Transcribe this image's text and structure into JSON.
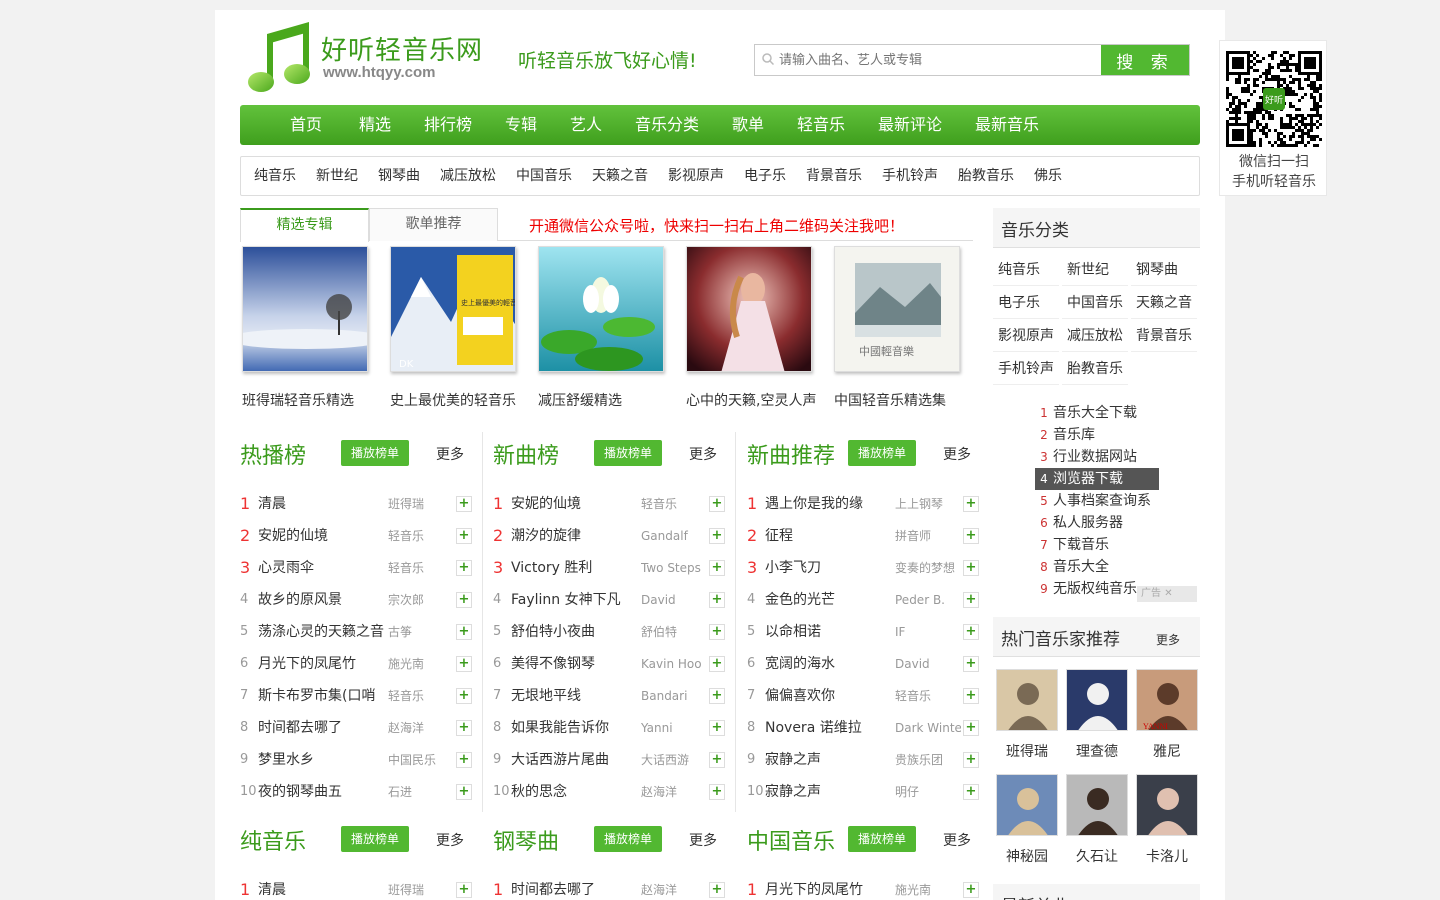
{
  "header": {
    "logo_text": "好听轻音乐网",
    "domain": "www.htqyy.com",
    "slogan": "听轻音乐放飞好心情!",
    "search_placeholder": "请输入曲名、艺人或专辑",
    "search_button": "搜 索"
  },
  "nav": [
    "首页",
    "精选",
    "排行榜",
    "专辑",
    "艺人",
    "音乐分类",
    "歌单",
    "轻音乐",
    "最新评论",
    "最新音乐"
  ],
  "subnav": [
    "纯音乐",
    "新世纪",
    "钢琴曲",
    "减压放松",
    "中国音乐",
    "天籁之音",
    "影视原声",
    "电子乐",
    "背景音乐",
    "手机铃声",
    "胎教音乐",
    "佛乐"
  ],
  "tabs": [
    "精选专辑",
    "歌单推荐"
  ],
  "notice": "开通微信公众号啦，快来扫一扫右上角二维码关注我吧！",
  "albums": [
    "班得瑞轻音乐精选",
    "史上最优美的轻音乐",
    "减压舒缓精选",
    "心中的天籁,空灵人声",
    "中国轻音乐精选集"
  ],
  "album_cover_text": [
    "史上最優美的輕音樂",
    "中國輕音樂"
  ],
  "charts": [
    {
      "title": "热播榜",
      "play": "播放榜单",
      "more": "更多",
      "rows": [
        [
          "1",
          "清晨",
          "班得瑞"
        ],
        [
          "2",
          "安妮的仙境",
          "轻音乐"
        ],
        [
          "3",
          "心灵雨伞",
          "轻音乐"
        ],
        [
          "4",
          "故乡的原风景",
          "宗次郎"
        ],
        [
          "5",
          "荡涤心灵的天籁之音",
          "古筝"
        ],
        [
          "6",
          "月光下的凤尾竹",
          "施光南"
        ],
        [
          "7",
          "斯卡布罗市集(口哨",
          "轻音乐"
        ],
        [
          "8",
          "时间都去哪了",
          "赵海洋"
        ],
        [
          "9",
          "梦里水乡",
          "中国民乐"
        ],
        [
          "10",
          "夜的钢琴曲五",
          "石进"
        ]
      ]
    },
    {
      "title": "新曲榜",
      "play": "播放榜单",
      "more": "更多",
      "rows": [
        [
          "1",
          "安妮的仙境",
          "轻音乐"
        ],
        [
          "2",
          "潮汐的旋律",
          "Gandalf"
        ],
        [
          "3",
          "Victory 胜利",
          "Two Steps"
        ],
        [
          "4",
          "Faylinn 女神下凡",
          "David"
        ],
        [
          "5",
          "舒伯特小夜曲",
          "舒伯特"
        ],
        [
          "6",
          "美得不像钢琴",
          "Kavin Hoo"
        ],
        [
          "7",
          "无垠地平线",
          "Bandari"
        ],
        [
          "8",
          "如果我能告诉你",
          "Yanni"
        ],
        [
          "9",
          "大话西游片尾曲",
          "大话西游"
        ],
        [
          "10",
          "秋的思念",
          "赵海洋"
        ]
      ]
    },
    {
      "title": "新曲推荐",
      "play": "播放榜单",
      "more": "更多",
      "rows": [
        [
          "1",
          "遇上你是我的缘",
          "上上钢琴"
        ],
        [
          "2",
          "征程",
          "拼音师"
        ],
        [
          "3",
          "小李飞刀",
          "变奏的梦想"
        ],
        [
          "4",
          "金色的光芒",
          "Peder B."
        ],
        [
          "5",
          "以命相诺",
          "IF"
        ],
        [
          "6",
          "宽阔的海水",
          "David"
        ],
        [
          "7",
          "偏偏喜欢你",
          "轻音乐"
        ],
        [
          "8",
          "Novera 诺维拉",
          "Dark Winter"
        ],
        [
          "9",
          "寂静之声",
          "贵族乐团"
        ],
        [
          "10",
          "寂静之声",
          "明仔"
        ]
      ]
    },
    {
      "title": "纯音乐",
      "play": "播放榜单",
      "more": "更多",
      "rows": [
        [
          "1",
          "清晨",
          "班得瑞"
        ]
      ]
    },
    {
      "title": "钢琴曲",
      "play": "播放榜单",
      "more": "更多",
      "rows": [
        [
          "1",
          "时间都去哪了",
          "赵海洋"
        ]
      ]
    },
    {
      "title": "中国音乐",
      "play": "播放榜单",
      "more": "更多",
      "rows": [
        [
          "1",
          "月光下的凤尾竹",
          "施光南"
        ]
      ]
    }
  ],
  "sidebar": {
    "category_title": "音乐分类",
    "categories": [
      "纯音乐",
      "新世纪",
      "钢琴曲",
      "电子乐",
      "中国音乐",
      "天籁之音",
      "影视原声",
      "减压放松",
      "背景音乐",
      "手机铃声",
      "胎教音乐"
    ],
    "ad_items": [
      [
        "1",
        "音乐大全下载"
      ],
      [
        "2",
        "音乐库"
      ],
      [
        "3",
        "行业数据网站"
      ],
      [
        "4",
        "浏览器下载"
      ],
      [
        "5",
        "人事档案查询系"
      ],
      [
        "6",
        "私人服务器"
      ],
      [
        "7",
        "下载音乐"
      ],
      [
        "8",
        "音乐大全"
      ],
      [
        "9",
        "无版权纯音乐"
      ]
    ],
    "ad_tag": "广告",
    "artist_title": "热门音乐家推荐",
    "artist_more": "更多",
    "artists": [
      "班得瑞",
      "理查德",
      "雅尼",
      "神秘园",
      "久石让",
      "卡洛儿"
    ],
    "artist_photo_text": "YANNI",
    "newest_title": "最新单曲"
  },
  "qr": {
    "line1": "微信扫一扫",
    "line2": "手机听轻音乐",
    "badge": "好听"
  }
}
